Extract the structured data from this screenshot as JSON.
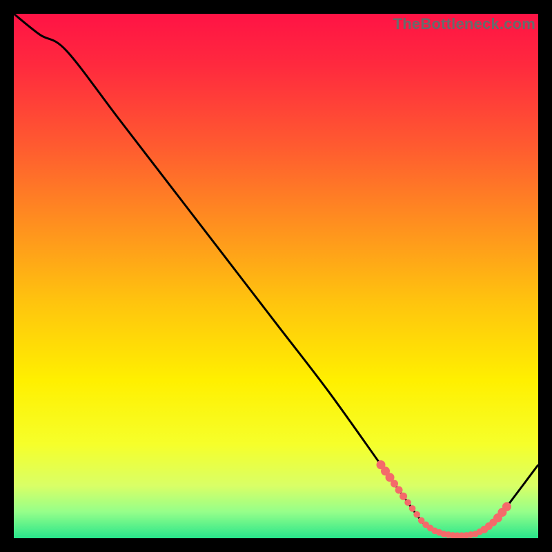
{
  "attribution": "TheBottleneck.com",
  "chart_data": {
    "type": "line",
    "title": "",
    "xlabel": "",
    "ylabel": "",
    "xlim": [
      0,
      100
    ],
    "ylim": [
      0,
      100
    ],
    "series": [
      {
        "name": "bottleneck-curve",
        "x": [
          0,
          5,
          10,
          20,
          30,
          40,
          50,
          60,
          70,
          75,
          78,
          80,
          82,
          84,
          86,
          88,
          90,
          92,
          94,
          100
        ],
        "y": [
          100,
          96,
          93,
          80,
          67,
          54,
          41,
          28,
          14,
          7,
          3,
          1.5,
          0.8,
          0.5,
          0.5,
          0.8,
          1.8,
          3.5,
          6,
          14
        ]
      }
    ],
    "dotted_segment": {
      "start_x": 70,
      "end_x": 94
    },
    "gradient_stops": [
      {
        "offset": 0.0,
        "color": "#ff1345"
      },
      {
        "offset": 0.1,
        "color": "#ff2a3e"
      },
      {
        "offset": 0.25,
        "color": "#ff5a30"
      },
      {
        "offset": 0.4,
        "color": "#ff8f1f"
      },
      {
        "offset": 0.55,
        "color": "#ffc40e"
      },
      {
        "offset": 0.7,
        "color": "#fff000"
      },
      {
        "offset": 0.82,
        "color": "#f6ff2a"
      },
      {
        "offset": 0.9,
        "color": "#d9ff66"
      },
      {
        "offset": 0.95,
        "color": "#95ff8a"
      },
      {
        "offset": 1.0,
        "color": "#28e58b"
      }
    ],
    "dot_color": "#f46a6a",
    "curve_color": "#000000"
  }
}
